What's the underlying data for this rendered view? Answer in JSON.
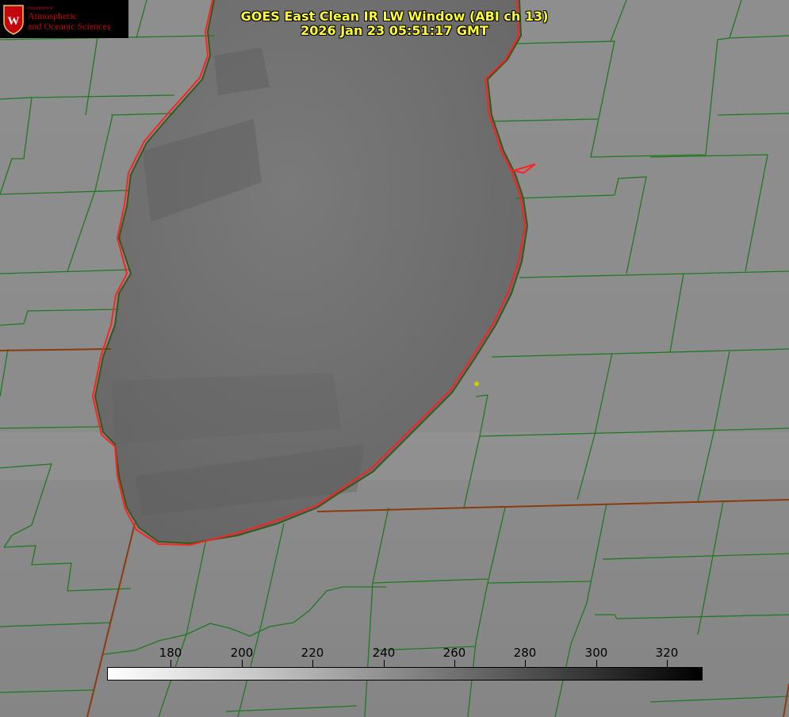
{
  "title": {
    "line1": "GOES East Clean IR LW Window (ABI ch 13)",
    "line2": "2026 Jan 23 05:51:17 GMT"
  },
  "logo": {
    "department": "Department of",
    "line1": "Atmospheric",
    "line2": "and Oceanic Sciences",
    "shield_letter": "W"
  },
  "colorbar": {
    "tick_labels": [
      "180",
      "200",
      "220",
      "240",
      "260",
      "280",
      "300",
      "320"
    ],
    "range": [
      162,
      330
    ],
    "ticks": [
      180,
      200,
      220,
      240,
      260,
      280,
      300,
      320
    ]
  },
  "colors": {
    "county_lines": "#1f7a1f",
    "lake_outline": "#ff2020",
    "state_line": "#8b4513",
    "title_text": "#ffff33",
    "marker": "#cccc00"
  },
  "icons": {
    "logo": "uw-crest-icon",
    "marker": "station-dot-icon"
  }
}
